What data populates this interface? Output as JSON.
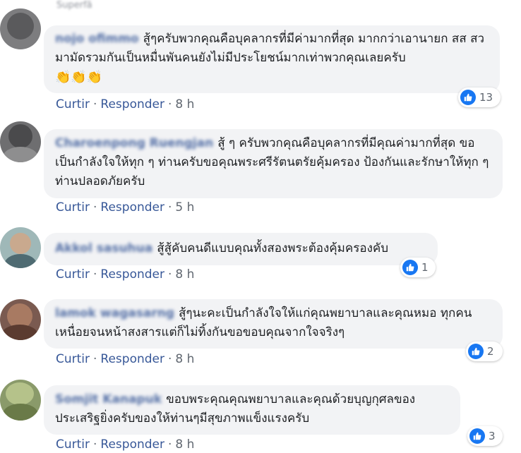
{
  "actions": {
    "like": "Curtir",
    "reply": "Responder",
    "dot": "·"
  },
  "comments": [
    {
      "badge": "Superfã",
      "author": "nojo ofimmo",
      "text": "สู้ๆครับพวกคุณคือบุคลากรที่มีค่ามากที่สุด มากกว่าเอานายก สส สว มามัดรวมกันเป็นหมื่นพันคนยังไม่มีประโยชน์มากเท่าพวกคุณเลยครับ",
      "emoji": "👏👏👏",
      "time": "8 h",
      "reactions": "13"
    },
    {
      "author": "Charoenpong Ruengjan",
      "text": "สู้ ๆ ครับพวกคุณคือบุคลากรที่มีคุณค่ามากที่สุด ขอเป็นกำลังใจให้ทุก ๆ ท่านครับขอคุณพระศรีรัตนตรัยคุ้มครอง ป้องกันและรักษาให้ทุก ๆ ท่านปลอดภัยครับ",
      "time": "5 h",
      "reactions": ""
    },
    {
      "author": "Akkol sasuhua",
      "text": "สู้สู้คับคนดีแบบคุณทั้งสองพระต้องคุ้มครองคับ",
      "time": "8 h",
      "reactions": "1"
    },
    {
      "author": "lamok wagasarng",
      "text": "สู้ๆนะคะเป็นกำลังใจให้แก่คุณพยาบาลและคุณหมอ ทุกคนเหนื่อยจนหน้าสงสารแต่ก็ไม่ทิ้งกันขอขอบคุณจากใจจริงๆ",
      "time": "8 h",
      "reactions": "2"
    },
    {
      "author": "Somjit Kanapuk",
      "text": "ขอบพระคุณคุณพยาบาลและคุณด้วยบุญกุศลของ ประเสริฐยิ่งครับของให้ท่านๆมีสุขภาพแข็งแรงครับ",
      "time": "8 h",
      "reactions": "3"
    }
  ]
}
